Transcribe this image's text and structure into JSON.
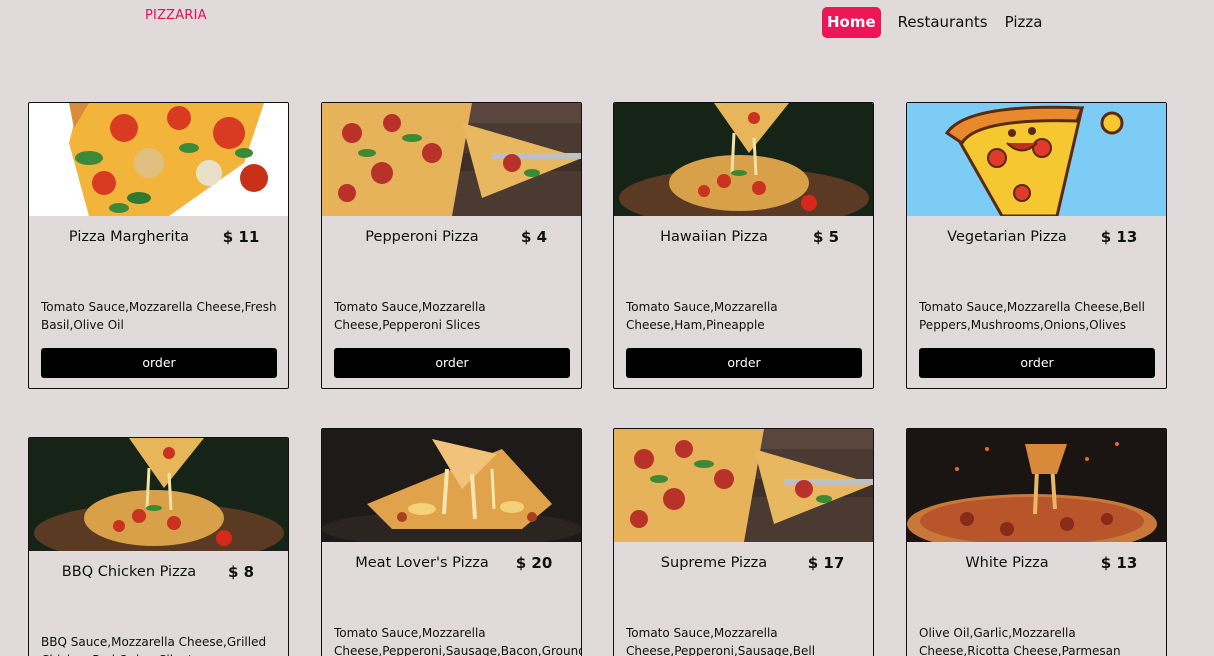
{
  "header": {
    "brand": "PIZZARIA",
    "nav": {
      "home": "Home",
      "restaurants": "Restaurants",
      "pizza": "Pizza"
    }
  },
  "cards": [
    {
      "title": "Pizza Margherita",
      "price": "$ 11",
      "ingredients": "Tomato Sauce,Mozzarella Cheese,Fresh Basil,Olive Oil",
      "order": "order"
    },
    {
      "title": "Pepperoni Pizza",
      "price": "$ 4",
      "ingredients": "Tomato Sauce,Mozzarella Cheese,Pepperoni Slices",
      "order": "order"
    },
    {
      "title": "Hawaiian Pizza",
      "price": "$ 5",
      "ingredients": "Tomato Sauce,Mozzarella Cheese,Ham,Pineapple",
      "order": "order"
    },
    {
      "title": "Vegetarian Pizza",
      "price": "$ 13",
      "ingredients": "Tomato Sauce,Mozzarella Cheese,Bell Peppers,Mushrooms,Onions,Olives",
      "order": "order"
    },
    {
      "title": "BBQ Chicken Pizza",
      "price": "$ 8",
      "ingredients": "BBQ Sauce,Mozzarella Cheese,Grilled Chicken,Red Onion,Cilantro"
    },
    {
      "title": "Meat Lover's Pizza",
      "price": "$ 20",
      "ingredients": "Tomato Sauce,Mozzarella Cheese,Pepperoni,Sausage,Bacon,Ground Beef"
    },
    {
      "title": "Supreme Pizza",
      "price": "$ 17",
      "ingredients": "Tomato Sauce,Mozzarella Cheese,Pepperoni,Sausage,Bell Peppers"
    },
    {
      "title": "White Pizza",
      "price": "$ 13",
      "ingredients": "Olive Oil,Garlic,Mozzarella Cheese,Ricotta Cheese,Parmesan"
    }
  ]
}
